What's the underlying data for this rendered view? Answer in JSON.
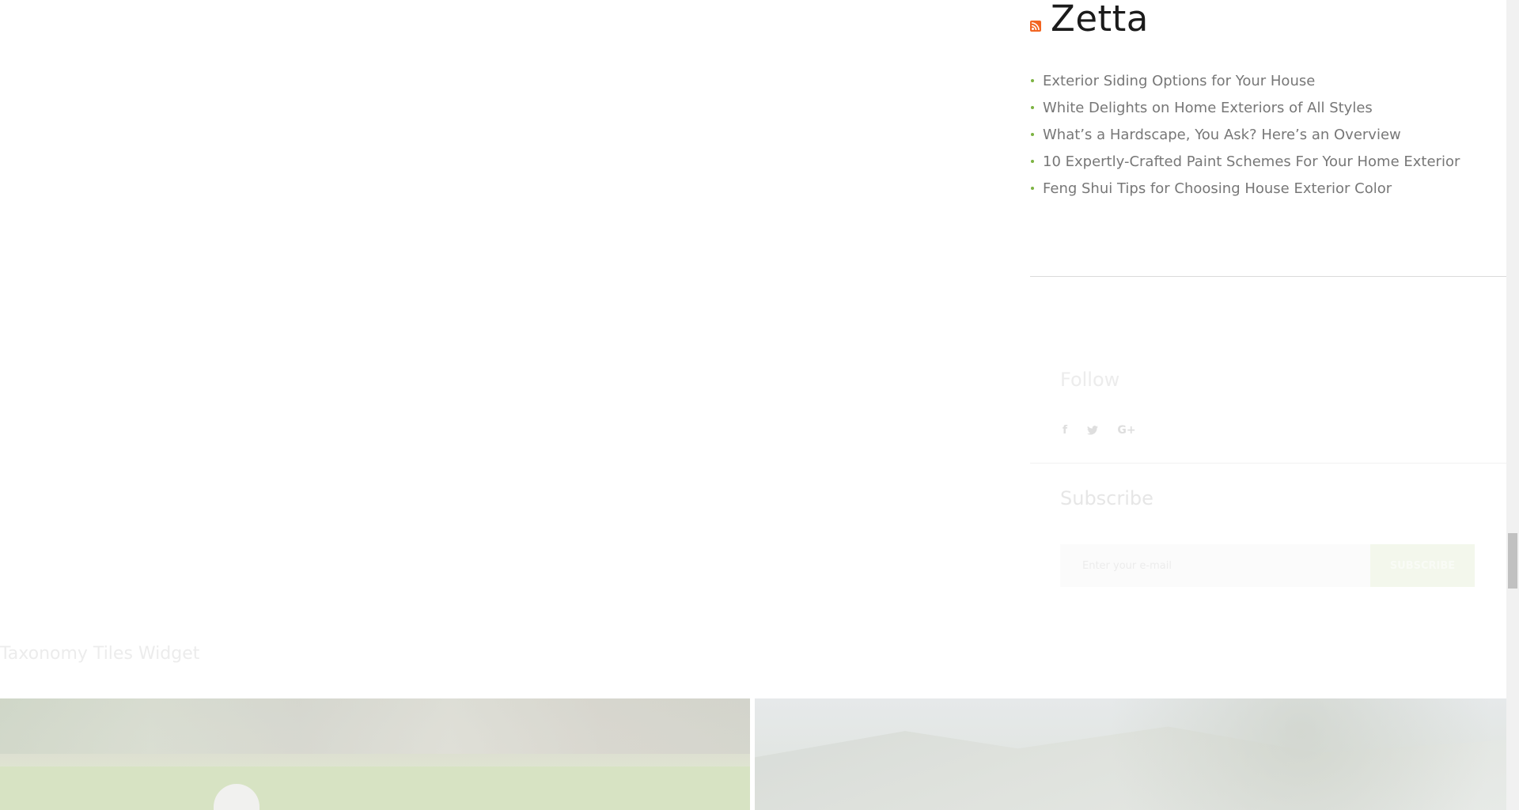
{
  "rss": {
    "title": "Zetta",
    "items": [
      "Exterior Siding Options for Your House",
      "White Delights on Home Exteriors of All Styles",
      "What’s a Hardscape, You Ask? Here’s an Overview",
      "10 Expertly-Crafted Paint Schemes For Your Home Exterior",
      "Feng Shui Tips for Choosing House Exterior Color"
    ]
  },
  "follow": {
    "title": "Follow",
    "facebook_glyph": "f",
    "twitter_glyph": "🐦",
    "googleplus_glyph": "G+"
  },
  "subscribe": {
    "title": "Subscribe",
    "placeholder": "Enter your e-mail",
    "button_label": "SUBSCRIBE"
  },
  "taxonomy": {
    "title": "Taxonomy Tiles Widget"
  },
  "colors": {
    "bullet": "#7cb342",
    "rss_icon": "#f26522"
  }
}
